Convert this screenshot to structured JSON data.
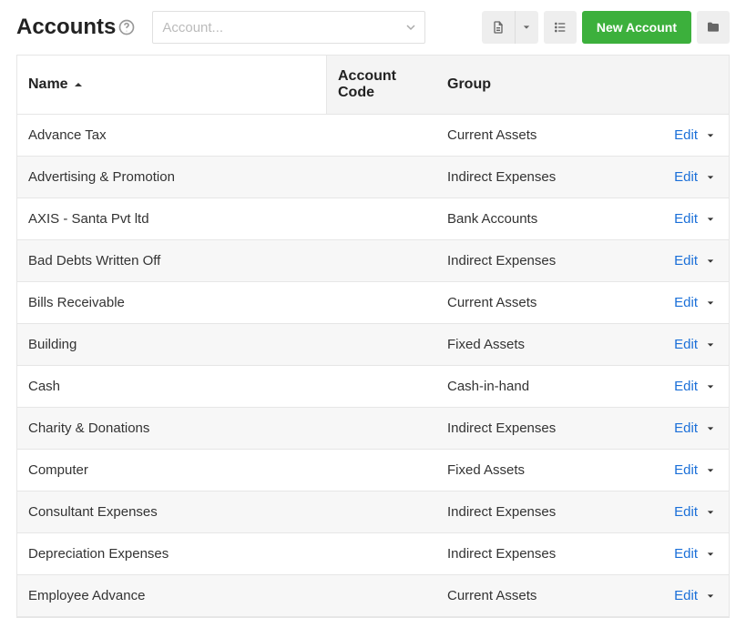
{
  "page": {
    "title": "Accounts"
  },
  "search": {
    "placeholder": "Account..."
  },
  "toolbar": {
    "new_label": "New Account"
  },
  "columns": {
    "name": "Name",
    "code": "Account Code",
    "group": "Group"
  },
  "edit_label": "Edit",
  "rows": [
    {
      "name": "Advance Tax",
      "code": "",
      "group": "Current Assets"
    },
    {
      "name": "Advertising & Promotion",
      "code": "",
      "group": "Indirect Expenses"
    },
    {
      "name": "AXIS - Santa Pvt ltd",
      "code": "",
      "group": "Bank Accounts"
    },
    {
      "name": "Bad Debts Written Off",
      "code": "",
      "group": "Indirect Expenses"
    },
    {
      "name": "Bills Receivable",
      "code": "",
      "group": "Current Assets"
    },
    {
      "name": "Building",
      "code": "",
      "group": "Fixed Assets"
    },
    {
      "name": "Cash",
      "code": "",
      "group": "Cash-in-hand"
    },
    {
      "name": "Charity & Donations",
      "code": "",
      "group": "Indirect Expenses"
    },
    {
      "name": "Computer",
      "code": "",
      "group": "Fixed Assets"
    },
    {
      "name": "Consultant Expenses",
      "code": "",
      "group": "Indirect Expenses"
    },
    {
      "name": "Depreciation Expenses",
      "code": "",
      "group": "Indirect Expenses"
    },
    {
      "name": "Employee Advance",
      "code": "",
      "group": "Current Assets"
    }
  ]
}
